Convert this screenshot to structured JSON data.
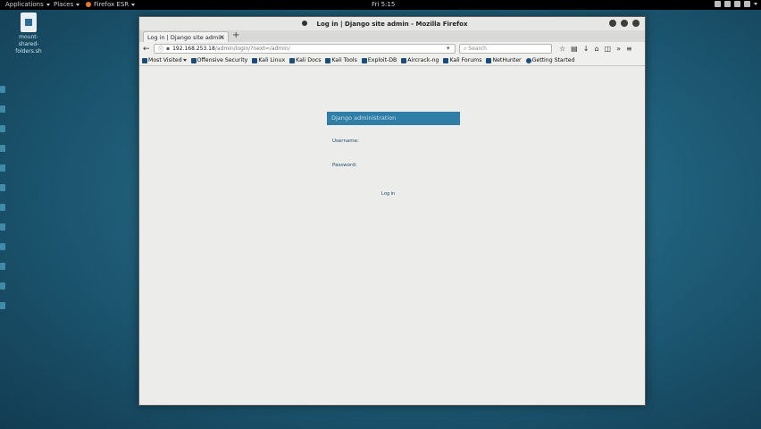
{
  "top_panel": {
    "applications": "Applications",
    "places": "Places",
    "firefox": "Firefox ESR",
    "clock": "Fri 5:15"
  },
  "desktop": {
    "file_label": "mount-shared-folders.sh"
  },
  "window": {
    "title": "Log in | Django site admin - Mozilla Firefox"
  },
  "tab": {
    "label": "Log in | Django site admin"
  },
  "navbar": {
    "url_host": "192.168.253.18",
    "url_path": "/admin/login/?next=/admin/",
    "search_placeholder": "Search"
  },
  "bookmarks": [
    {
      "label": "Most Visited",
      "icon": "gear-icon"
    },
    {
      "label": "Offensive Security",
      "icon": "offsec-icon"
    },
    {
      "label": "Kali Linux",
      "icon": "kali-icon"
    },
    {
      "label": "Kali Docs",
      "icon": "kali-icon"
    },
    {
      "label": "Kali Tools",
      "icon": "kali-icon"
    },
    {
      "label": "Exploit-DB",
      "icon": "exploitdb-icon"
    },
    {
      "label": "Aircrack-ng",
      "icon": "aircrack-icon"
    },
    {
      "label": "Kali Forums",
      "icon": "kali-icon"
    },
    {
      "label": "NetHunter",
      "icon": "kali-icon"
    },
    {
      "label": "Getting Started",
      "icon": "globe-icon"
    }
  ],
  "page": {
    "header": "Django administration",
    "username_label": "Username:",
    "password_label": "Password:",
    "login_button": "Log in"
  },
  "colors": {
    "django_header": "#2f7ea8",
    "desktop_bg": "#1f5f7a"
  }
}
